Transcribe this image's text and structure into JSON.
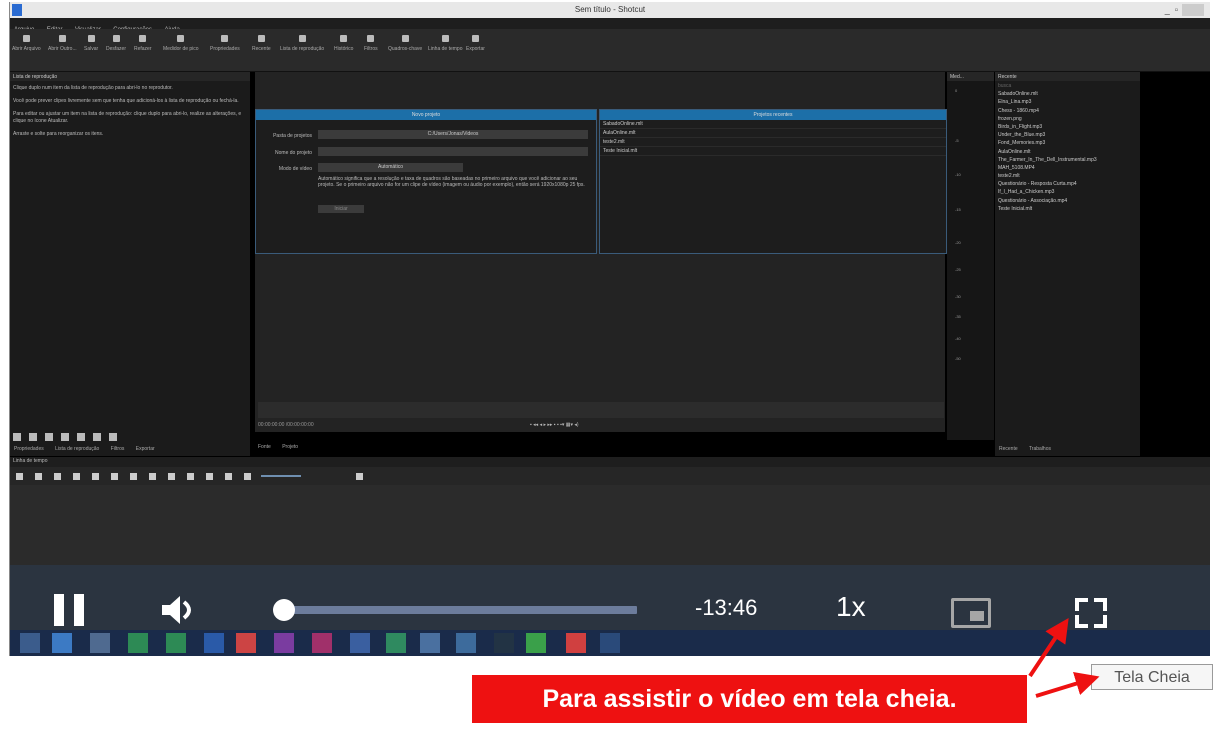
{
  "window": {
    "title": "Sem título - Shotcut"
  },
  "menu": [
    "Arquivo",
    "Editar",
    "Visualizar",
    "Configurações",
    "Ajuda"
  ],
  "toolbar": [
    "Abrir Arquivo",
    "Abrir Outro...",
    "Salvar",
    "Desfazer",
    "Refazer",
    "Medidor de pico",
    "Propriedades",
    "Recente",
    "Lista de reprodução",
    "Histórico",
    "Filtros",
    "Quadros-chave",
    "Linha de tempo",
    "Exportar"
  ],
  "playlist": {
    "title": "Lista de reprodução",
    "hints": [
      "Clique duplo num item da lista de reprodução para abri-lo no reprodutor.",
      "Você pode prever clipes livremente sem que tenha que adicioná-los à lista de reprodução ou fechá-la.",
      "Para editar ou ajustar um item na lista de reprodução: clique duplo para abri-lo, realize as alterações, e clique no ícone Atualizar.",
      "Arraste e solte para reorganizar os itens."
    ]
  },
  "left_tabs": [
    "Propriedades",
    "Lista de reprodução",
    "Filtros",
    "Exportar"
  ],
  "new_project": {
    "header": "Novo projeto",
    "folder_label": "Pasta de projetos",
    "folder_value": "C:/Users/Jonas/Videos",
    "name_label": "Nome do projeto",
    "mode_label": "Modo de vídeo",
    "mode_value": "Automático",
    "description": "Automático significa que a resolução e taxa de quadros são baseadas no primeiro arquivo que você adicionar ao seu projeto. Se o primeiro arquivo não for um clipe de vídeo (imagem ou áudio por exemplo), então será 1920x1080p 25 fps.",
    "start_button": "Iniciar"
  },
  "recent_projects": {
    "header": "Projetos recentes",
    "items": [
      "SabadoOnline.mlt",
      "AulaOnline.mlt",
      "teste2.mlt",
      "Teste Inicial.mlt"
    ]
  },
  "player": {
    "timecode": "00:00:00:00",
    "duration": "/00:00:00:00"
  },
  "center_tabs": [
    "Fonte",
    "Projeto"
  ],
  "meter": {
    "title": "Med...",
    "ticks": [
      "0",
      "-5",
      "-10",
      "-15",
      "-20",
      "-25",
      "-30",
      "-35",
      "-40",
      "-50"
    ]
  },
  "recent": {
    "title": "Recente",
    "search": "busca",
    "items": [
      "SabadoOnline.mlt",
      "Elna_Lina.mp3",
      "Chess - 1860.mp4",
      "frozen.png",
      "Birds_in_Flight.mp3",
      "Under_the_Blue.mp3",
      "Fond_Memories.mp3",
      "AulaOnline.mlt",
      "The_Farmer_In_The_Dell_Instrumental.mp3",
      "MAH_5108.MP4",
      "teste2.mlt",
      "Questionário - Resposta Curta.mp4",
      "If_I_Had_a_Chicken.mp3",
      "Questionário - Associação.mp4",
      "Teste Inicial.mlt"
    ]
  },
  "right_tabs": [
    "Recente",
    "Trabalhos"
  ],
  "timeline": {
    "title": "Linha de tempo"
  },
  "video_controls": {
    "time_remaining": "-13:46",
    "rate": "1x",
    "progress": 0.02
  },
  "annotation": {
    "callout": "Para assistir o vídeo em tela cheia.",
    "tooltip": "Tela Cheia",
    "color": "#ee1111"
  }
}
